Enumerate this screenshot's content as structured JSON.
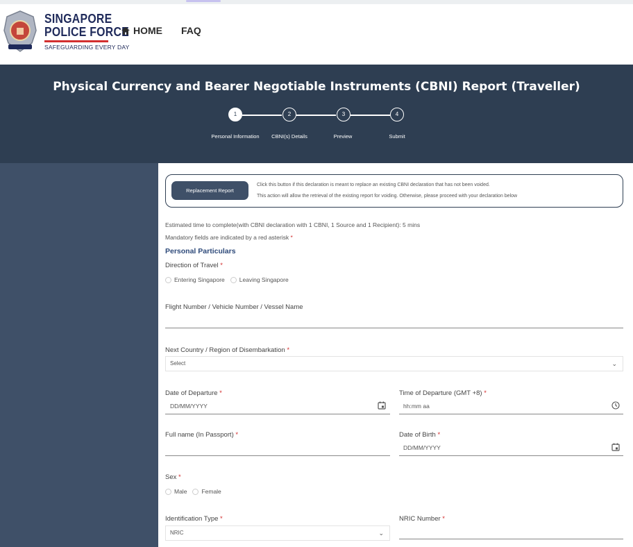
{
  "header": {
    "logo_line1": "SINGAPORE",
    "logo_line2": "POLICE FORCE",
    "logo_tagline": "SAFEGUARDING EVERY DAY",
    "nav_home": "HOME",
    "nav_faq": "FAQ",
    "home_icon": "home-icon",
    "crest_icon": "police-crest-icon"
  },
  "banner": {
    "title": "Physical Currency and Bearer Negotiable Instruments (CBNI) Report (Traveller)",
    "steps": [
      {
        "num": "1",
        "label": "Personal Information"
      },
      {
        "num": "2",
        "label": "CBNI(s) Details"
      },
      {
        "num": "3",
        "label": "Preview"
      },
      {
        "num": "4",
        "label": "Submit"
      }
    ],
    "active_step": 1
  },
  "replacement": {
    "button": "Replacement Report",
    "line1": "Click this button if this declaration is meant to replace an existing CBNI declaration that has not been voided.",
    "line2": "This action will allow the retrieval of the existing report for voiding. Otherwise, please proceed with your declaration below"
  },
  "form": {
    "estimate": "Estimated time to complete(with CBNI declaration with 1 CBNI, 1 Source and 1 Recipient): 5 mins",
    "mandatory_note": "Mandatory fields are indicated by a red asterisk",
    "asterisk": "*",
    "section_title": "Personal Particulars",
    "direction_label": "Direction of Travel",
    "direction_options": [
      "Entering Singapore",
      "Leaving Singapore"
    ],
    "flight_label": "Flight Number / Vehicle Number / Vessel Name",
    "next_country_label": "Next Country / Region of Disembarkation",
    "next_country_value": "Select",
    "date_departure_label": "Date of Departure",
    "date_departure_placeholder": "DD/MM/YYYY",
    "time_departure_label": "Time of Departure (GMT +8)",
    "time_departure_placeholder": "hh:mm aa",
    "full_name_label": "Full name (In Passport)",
    "dob_label": "Date of Birth",
    "dob_placeholder": "DD/MM/YYYY",
    "sex_label": "Sex",
    "sex_options": [
      "Male",
      "Female"
    ],
    "id_type_label": "Identification Type",
    "id_type_value": "NRIC",
    "nric_label": "NRIC Number"
  },
  "colors": {
    "banner": "#2e3e52",
    "side_panel": "#3f5068",
    "required": "#d32f2f",
    "section": "#2e4a7a"
  }
}
